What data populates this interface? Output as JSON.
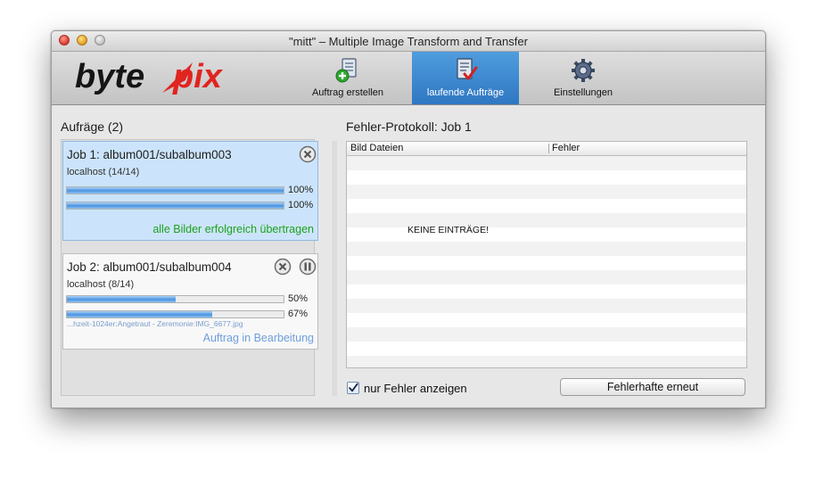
{
  "window": {
    "title": "\"mitt\" – Multiple Image Transform and Transfer"
  },
  "logo": {
    "text_left": "byte",
    "text_right": "pix"
  },
  "toolbar": {
    "create_job": {
      "label": "Auftrag erstellen",
      "icon": "document-add-icon"
    },
    "running_jobs": {
      "label": "laufende Aufträge",
      "icon": "document-check-icon",
      "active": true
    },
    "settings": {
      "label": "Einstellungen",
      "icon": "gear-icon"
    }
  },
  "jobs_panel": {
    "title": "Aufräge (2)",
    "jobs": [
      {
        "title": "Job 1: album001/subalbum003",
        "host": "localhost (14/14)",
        "progress1": 1.0,
        "progress1_label": "100%",
        "progress2": 1.0,
        "progress2_label": "100%",
        "current_file": "",
        "status": "alle Bilder erfolgreich übertragen",
        "status_color": "#1ea21e",
        "selected": true
      },
      {
        "title": "Job 2: album001/subalbum004",
        "host": "localhost (8/14)",
        "progress1": 0.5,
        "progress1_label": "50%",
        "progress2": 0.67,
        "progress2_label": "67%",
        "current_file": "...hzeit-1024er:Angetraut - Zeremonie:IMG_6677.jpg",
        "status": "Auftrag in Bearbeitung",
        "status_color": "#6f9fdc",
        "selected": false
      }
    ]
  },
  "error_log": {
    "title": "Fehler-Protokoll: Job 1",
    "columns": [
      "Bild Dateien",
      "Fehler"
    ],
    "empty_text": "KEINE EINTRÄGE!",
    "only_errors_label": "nur Fehler anzeigen",
    "only_errors_checked": true,
    "retry_button": "Fehlerhafte erneut"
  },
  "colors": {
    "accent": "#2f77c2",
    "logo_red": "#e0241f"
  }
}
